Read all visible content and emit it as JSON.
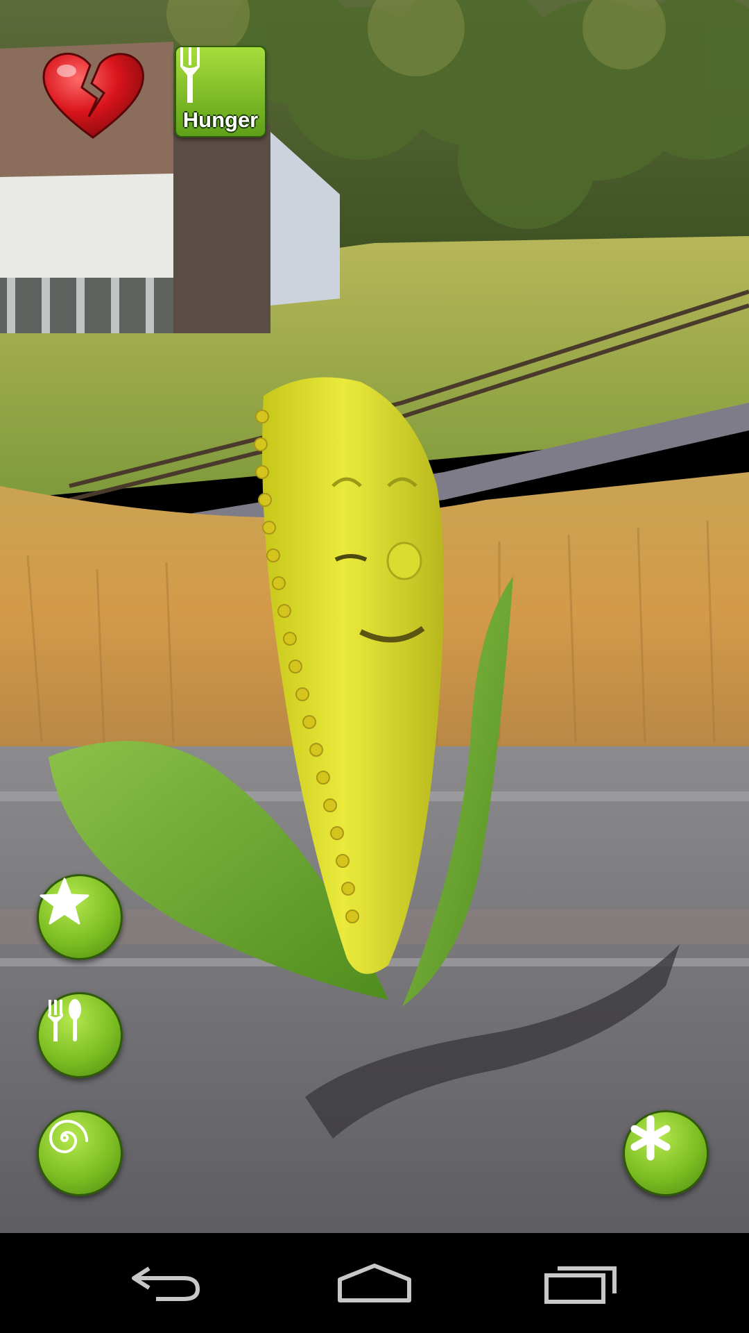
{
  "hud": {
    "health_icon": "broken-heart-icon",
    "hunger_label": "Hunger",
    "hunger_icon": "fork-icon"
  },
  "controls": [
    {
      "name": "favorite",
      "icon": "star-icon"
    },
    {
      "name": "feed",
      "icon": "fork-spoon-icon"
    },
    {
      "name": "hypnotize",
      "icon": "spiral-icon"
    },
    {
      "name": "more",
      "icon": "asterisk-icon"
    }
  ],
  "colors": {
    "button_green": "#7dbe23",
    "button_border": "#2f5a09",
    "heart_red": "#d8141b",
    "corn_yellow": "#e6e32a",
    "leaf_green": "#6fae2c",
    "navbar": "#000000"
  },
  "navbar": {
    "back_icon": "back-icon",
    "home_icon": "home-icon",
    "recents_icon": "recents-icon"
  }
}
